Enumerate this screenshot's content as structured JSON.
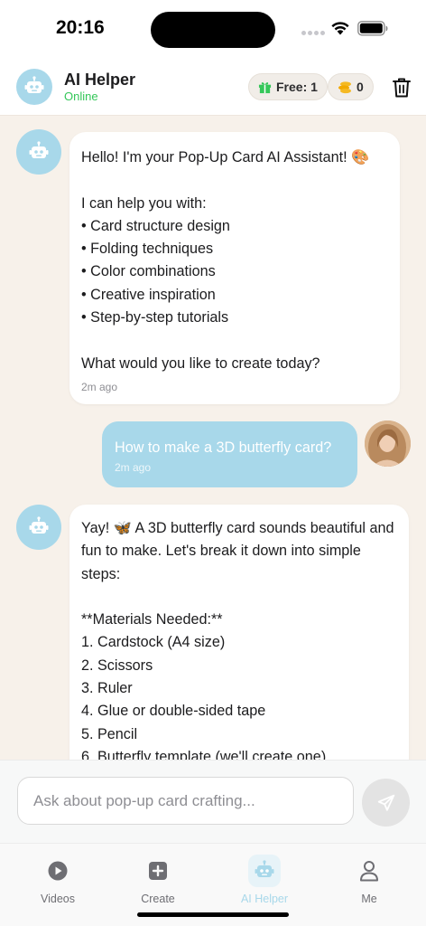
{
  "status_bar": {
    "time": "20:16"
  },
  "header": {
    "title": "AI Helper",
    "status": "Online",
    "free_label": "Free: 1",
    "coins": "0"
  },
  "messages": [
    {
      "sender": "bot",
      "text": "Hello! I'm your Pop-Up Card AI Assistant! 🎨\n\nI can help you with:\n• Card structure design\n• Folding techniques\n• Color combinations\n• Creative inspiration\n• Step-by-step tutorials\n\nWhat would you like to create today?",
      "time": "2m ago"
    },
    {
      "sender": "user",
      "text": "How to make a 3D butterfly card?",
      "time": "2m ago"
    },
    {
      "sender": "bot",
      "text": "Yay! 🦋  A 3D butterfly card sounds beautiful and fun to make. Let's break it down into simple steps:\n\n**Materials Needed:**\n1. Cardstock (A4 size)\n2. Scissors\n3. Ruler\n4. Glue or double-sided tape\n5. Pencil\n6. Butterfly template (we'll create one)"
    }
  ],
  "input": {
    "placeholder": "Ask about pop-up card crafting..."
  },
  "tabs": [
    {
      "label": "Videos",
      "icon": "play-circle-icon"
    },
    {
      "label": "Create",
      "icon": "plus-square-icon"
    },
    {
      "label": "AI Helper",
      "icon": "robot-icon",
      "active": true
    },
    {
      "label": "Me",
      "icon": "person-icon"
    }
  ],
  "colors": {
    "accent": "#a8d8ea",
    "online": "#34c759",
    "background": "#f7f1ea"
  }
}
